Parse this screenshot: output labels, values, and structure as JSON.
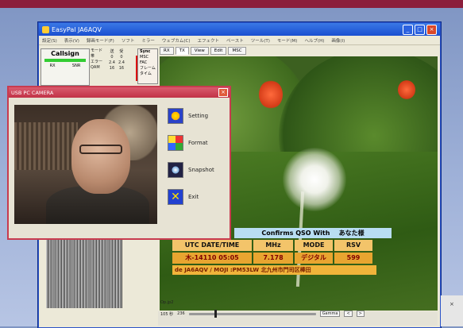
{
  "app": {
    "title": "EasyPal  JA6AQV",
    "menu": [
      "設定(S)",
      "表示(V)",
      "録画モード(F)",
      "ソフト",
      "ミラー",
      "ウェブカム(C)",
      "エフェクト",
      "ペースト",
      "ツール(T)",
      "モード(M)",
      "ヘルプ(H)",
      "画像(I)"
    ]
  },
  "status": {
    "callsign": "Callsign",
    "rx_label": "RX",
    "snr_label": "SNR",
    "left_labels": [
      "モード",
      "帯",
      "エラー",
      "QAM"
    ],
    "grid": [
      [
        "送",
        "0",
        "2.4",
        "16"
      ],
      [
        "受",
        "0",
        "2.4",
        "16"
      ]
    ],
    "sync_header": "Sync",
    "sync_items": [
      "MSC",
      "FAC",
      "フレーム",
      "タイム"
    ]
  },
  "tabs": [
    "RX",
    "TX",
    "View",
    "Edit",
    "MSC"
  ],
  "qso": {
    "header": "Confirms QSO With",
    "header_name": "あなた様",
    "columns": [
      "UTC DATE/TIME",
      "MHz",
      "MODE",
      "RSV"
    ],
    "values": [
      "木-14110 05:05",
      "7.178",
      "デジタル",
      "599"
    ],
    "de_line": "de  JA6AQV / MOJI :PM53LW  北九州市門司区棒田"
  },
  "bottom": {
    "op_label": "Op.jp2",
    "left_value": "105 秒",
    "mid_value": "236",
    "gamma_label": "Gamma"
  },
  "camera": {
    "title": "USB PC CAMERA",
    "buttons": [
      "Setting",
      "Format",
      "Snapshot",
      "Exit"
    ]
  },
  "colors": {
    "cam_border": "#c83b4f",
    "qso_header": "#b8ddf2",
    "qso_cell": "#e8a530"
  }
}
